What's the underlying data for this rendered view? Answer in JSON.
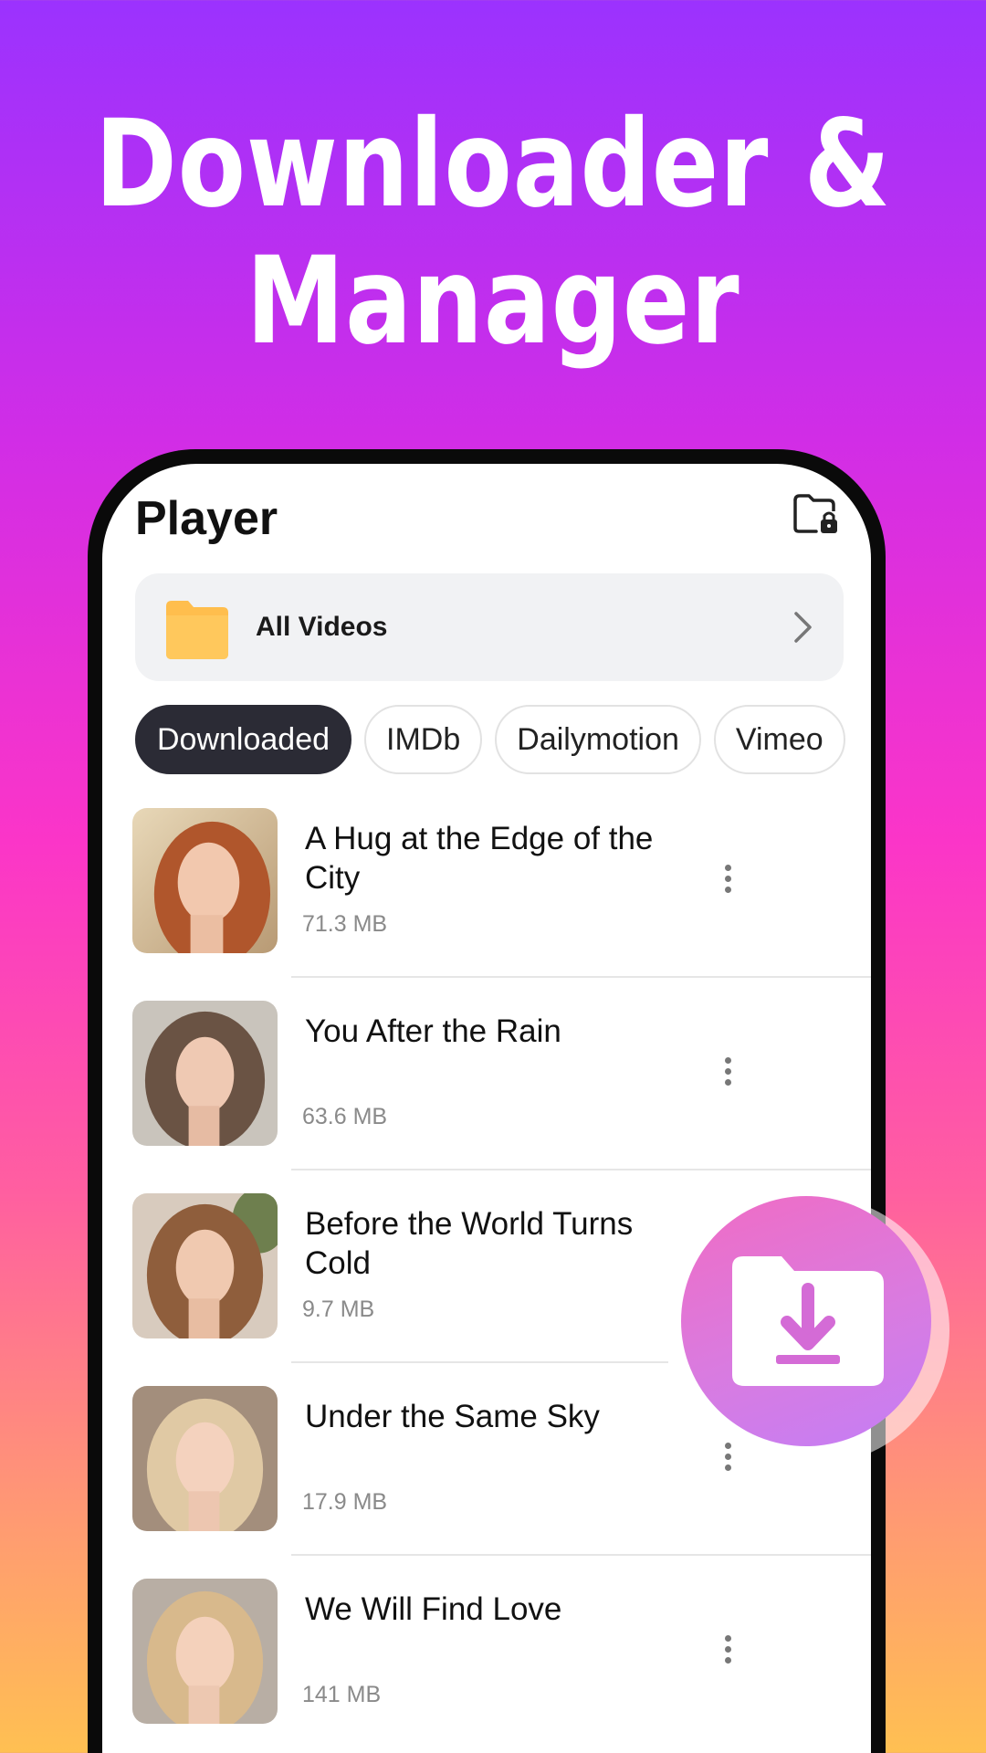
{
  "headline": {
    "line1": "Downloader &",
    "line2": "Manager"
  },
  "app": {
    "title": "Player",
    "lock_folder_icon": "folder-lock-icon"
  },
  "all_videos": {
    "label": "All Videos",
    "icon": "folder-icon",
    "chevron": "chevron-right-icon"
  },
  "tabs": [
    {
      "label": "Downloaded",
      "active": true
    },
    {
      "label": "IMDb",
      "active": false
    },
    {
      "label": "Dailymotion",
      "active": false
    },
    {
      "label": "Vimeo",
      "active": false
    }
  ],
  "videos": [
    {
      "title": "A Hug at the Edge of the City",
      "size": "71.3 MB"
    },
    {
      "title": "You After the Rain",
      "size": "63.6 MB"
    },
    {
      "title": "Before the World Turns Cold",
      "size": "9.7 MB"
    },
    {
      "title": "Under the Same Sky",
      "size": "17.9 MB"
    },
    {
      "title": "We Will Find Love",
      "size": "141 MB"
    }
  ],
  "fab": {
    "icon": "download-folder-icon"
  },
  "colors": {
    "accent_dark": "#2B2B35",
    "folder": "#FFBE4D",
    "fab_pink": "#F06CC4",
    "fab_violet": "#C47EF5"
  }
}
